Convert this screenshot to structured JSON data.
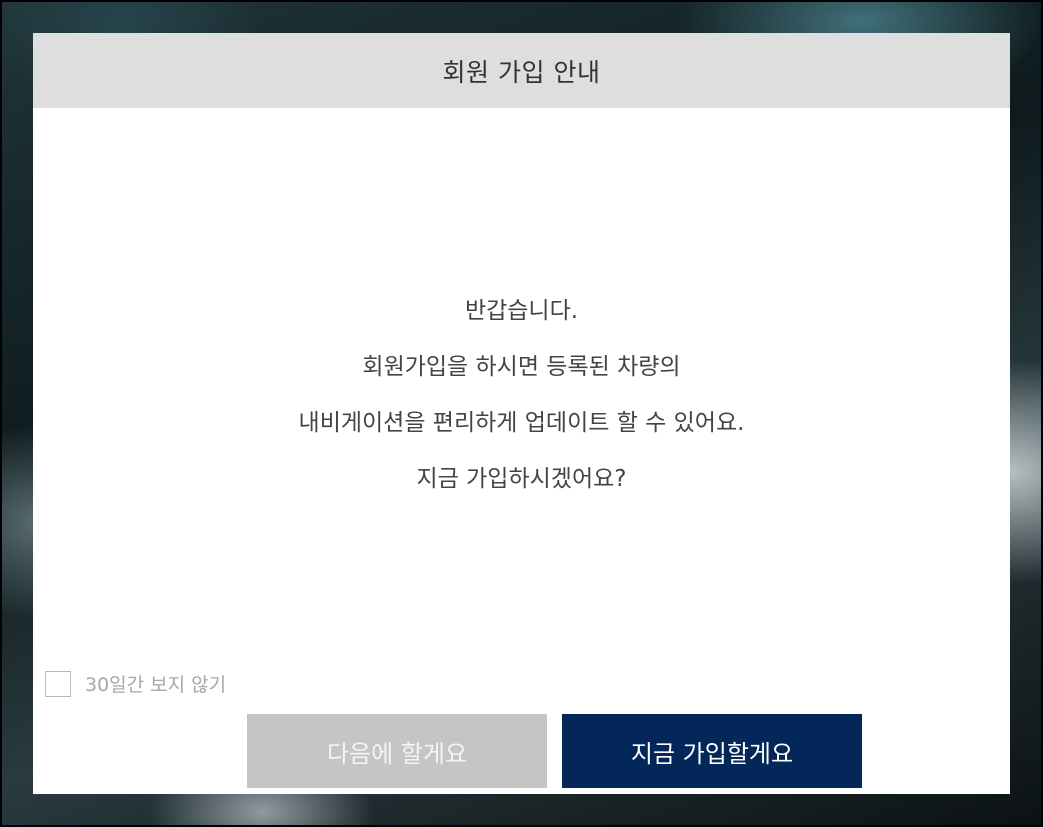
{
  "dialog": {
    "title": "회원 가입 안내",
    "message_lines": [
      "반갑습니다.",
      "회원가입을 하시면 등록된 차량의",
      "내비게이션을 편리하게 업데이트 할 수 있어요.",
      "지금 가입하시겠어요?"
    ],
    "skip_checkbox": {
      "label": "30일간 보지 않기",
      "checked": false
    },
    "buttons": {
      "later_label": "다음에 할게요",
      "join_label": "지금 가입할게요"
    }
  },
  "colors": {
    "header_bg": "#dedede",
    "primary_button": "#032758",
    "secondary_button": "#c5c5c5"
  }
}
